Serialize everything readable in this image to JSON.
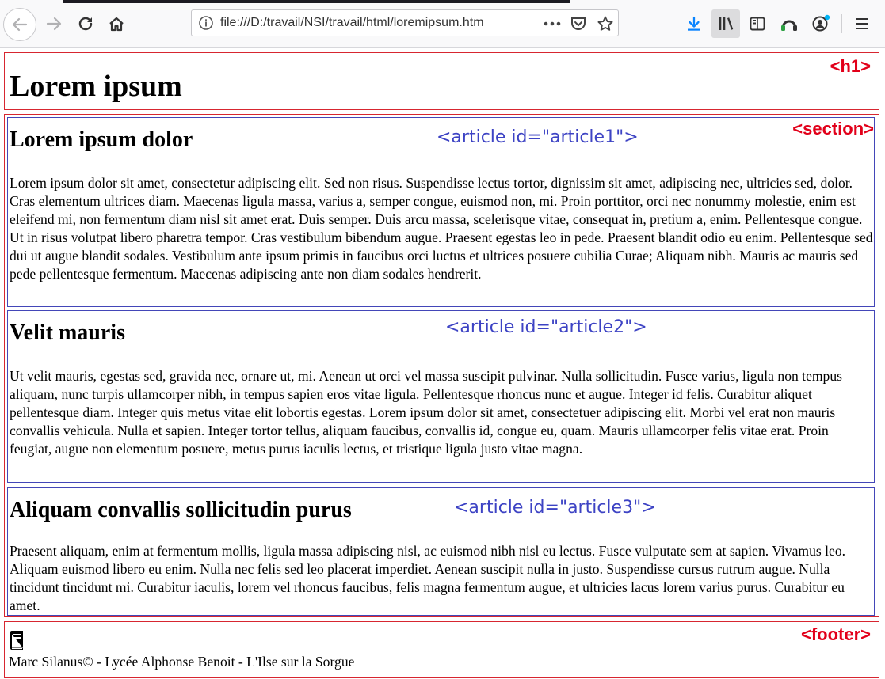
{
  "browser": {
    "url": "file:///D:/travail/NSI/travail/html/loremipsum.htm",
    "colors": {
      "toolbar_bg": "#f9f9fa",
      "download_accent": "#0a84ff"
    }
  },
  "page": {
    "h1": "Lorem ipsum",
    "h1_tag": "<h1>",
    "section_tag": "<section>",
    "articles": [
      {
        "tag": "<article id=\"article1\">",
        "title": "Lorem ipsum dolor",
        "text": "Lorem ipsum dolor sit amet, consectetur adipiscing elit. Sed non risus. Suspendisse lectus tortor, dignissim sit amet, adipiscing nec, ultricies sed, dolor. Cras elementum ultrices diam. Maecenas ligula massa, varius a, semper congue, euismod non, mi. Proin porttitor, orci nec nonummy molestie, enim est eleifend mi, non fermentum diam nisl sit amet erat. Duis semper. Duis arcu massa, scelerisque vitae, consequat in, pretium a, enim. Pellentesque congue. Ut in risus volutpat libero pharetra tempor. Cras vestibulum bibendum augue. Praesent egestas leo in pede. Praesent blandit odio eu enim. Pellentesque sed dui ut augue blandit sodales. Vestibulum ante ipsum primis in faucibus orci luctus et ultrices posuere cubilia Curae; Aliquam nibh. Mauris ac mauris sed pede pellentesque fermentum. Maecenas adipiscing ante non diam sodales hendrerit."
      },
      {
        "tag": "<article id=\"article2\">",
        "title": "Velit mauris",
        "text": "Ut velit mauris, egestas sed, gravida nec, ornare ut, mi. Aenean ut orci vel massa suscipit pulvinar. Nulla sollicitudin. Fusce varius, ligula non tempus aliquam, nunc turpis ullamcorper nibh, in tempus sapien eros vitae ligula. Pellentesque rhoncus nunc et augue. Integer id felis. Curabitur aliquet pellentesque diam. Integer quis metus vitae elit lobortis egestas. Lorem ipsum dolor sit amet, consectetuer adipiscing elit. Morbi vel erat non mauris convallis vehicula. Nulla et sapien. Integer tortor tellus, aliquam faucibus, convallis id, congue eu, quam. Mauris ullamcorper felis vitae erat. Proin feugiat, augue non elementum posuere, metus purus iaculis lectus, et tristique ligula justo vitae magna."
      },
      {
        "tag": "<article id=\"article3\">",
        "title": "Aliquam convallis sollicitudin purus",
        "text": "Praesent aliquam, enim at fermentum mollis, ligula massa adipiscing nisl, ac euismod nibh nisl eu lectus. Fusce vulputate sem at sapien. Vivamus leo. Aliquam euismod libero eu enim. Nulla nec felis sed leo placerat imperdiet. Aenean suscipit nulla in justo. Suspendisse cursus rutrum augue. Nulla tincidunt tincidunt mi. Curabitur iaculis, lorem vel rhoncus faucibus, felis magna fermentum augue, et ultricies lacus lorem varius purus. Curabitur eu amet."
      }
    ],
    "footer_tag": "<footer>",
    "footer_text": "Marc Silanus© - Lycée Alphonse Benoit - L'Ilse sur la Sorgue",
    "colors": {
      "tag_red": "#e2001a",
      "article_blue": "#3d43c4",
      "border_red": "#d72630",
      "border_blue": "#4346b8"
    }
  }
}
